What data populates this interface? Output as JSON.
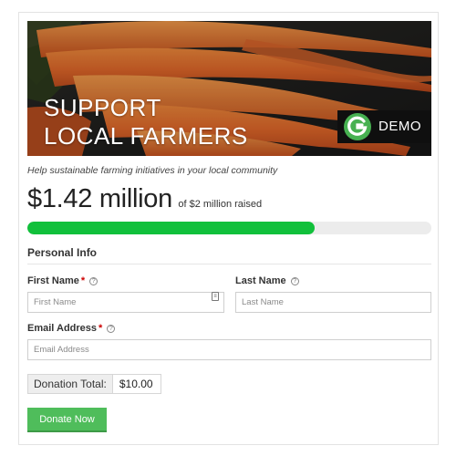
{
  "banner": {
    "title_line1": "SUPPORT",
    "title_line2": "LOCAL FARMERS",
    "badge_text": "DEMO",
    "badge_icon": "give-logo-icon",
    "accent_color": "#47b151"
  },
  "tagline": "Help sustainable farming initiatives in your local community",
  "goal": {
    "raised": "$1.42 million",
    "of_goal": "of $2 million raised",
    "progress_fraction": 0.71,
    "bar_color": "#11c03b"
  },
  "form": {
    "section_title": "Personal Info",
    "first_name": {
      "label": "First Name",
      "required": "*",
      "placeholder": "First Name",
      "value": ""
    },
    "last_name": {
      "label": "Last Name",
      "placeholder": "Last Name",
      "value": ""
    },
    "email": {
      "label": "Email Address",
      "required": "*",
      "placeholder": "Email Address",
      "value": ""
    },
    "help_glyph": "?",
    "donation_total_label": "Donation Total:",
    "donation_total_value": "$10.00",
    "submit_label": "Donate Now",
    "submit_color": "#4fbd5b"
  }
}
